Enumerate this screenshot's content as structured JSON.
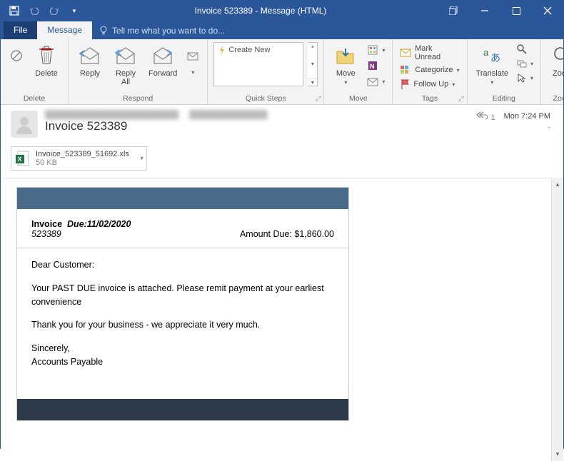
{
  "titlebar": {
    "title": "Invoice 523389 - Message (HTML)"
  },
  "tabs": {
    "file": "File",
    "message": "Message",
    "tell": "Tell me what you want to do..."
  },
  "ribbon": {
    "delete": {
      "delete": "Delete",
      "group": "Delete"
    },
    "respond": {
      "reply": "Reply",
      "replyall": "Reply\nAll",
      "forward": "Forward",
      "group": "Respond"
    },
    "quicksteps": {
      "create": "Create New",
      "group": "Quick Steps"
    },
    "move": {
      "move": "Move",
      "group": "Move"
    },
    "tags": {
      "unread": "Mark Unread",
      "categorize": "Categorize",
      "followup": "Follow Up",
      "group": "Tags"
    },
    "editing": {
      "translate": "Translate",
      "group": "Editing"
    },
    "zoom": {
      "zoom": "Zoom",
      "group": "Zoom"
    }
  },
  "message": {
    "subject": "Invoice 523389",
    "reply_count": "1",
    "date": "Mon 7:24 PM",
    "attachment": {
      "name": "Invoice_523389_51692.xls",
      "size": "50 KB"
    }
  },
  "invoice": {
    "label": "Invoice",
    "number": "523389",
    "due_label": "Due:11/02/2020",
    "amount_label": "Amount Due: $1,860.00",
    "greeting": "Dear Customer:",
    "p1": "Your PAST DUE invoice is attached. Please remit payment at your earliest convenience",
    "p2": "Thank you for your business - we appreciate it very much.",
    "sig1": "Sincerely,",
    "sig2": "Accounts Payable"
  }
}
